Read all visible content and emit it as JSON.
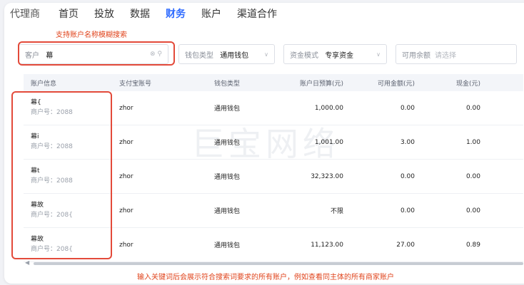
{
  "nav": {
    "brand": "代理商",
    "items": [
      "首页",
      "投放",
      "数据",
      "财务",
      "账户",
      "渠道合作"
    ],
    "active_index": 3
  },
  "hint_top": "支持账户名称模糊搜索",
  "filters": {
    "customer": {
      "label": "客户",
      "value": "幕"
    },
    "wallet": {
      "label": "钱包类型",
      "value": "通用钱包"
    },
    "fund": {
      "label": "资金模式",
      "value": "专享资金"
    },
    "balance": {
      "label": "可用余额",
      "placeholder": "请选择"
    }
  },
  "table": {
    "headers": [
      "账户信息",
      "支付宝账号",
      "钱包类型",
      "账户日预算(元)",
      "可用金额(元)",
      "现金(元)"
    ],
    "rows": [
      {
        "name": "幕{",
        "merchant": "商户号：2088",
        "alipay": "zhor",
        "wallet": "通用钱包",
        "budget": "1,000.00",
        "available": "0.00",
        "cash": "0.00"
      },
      {
        "name": "幕i",
        "merchant": "商户号：2088",
        "alipay": "zhor",
        "wallet": "通用钱包",
        "budget": "1,001.00",
        "available": "3.00",
        "cash": "1.00"
      },
      {
        "name": "幕t",
        "merchant": "商户号：2088",
        "alipay": "zhor",
        "wallet": "通用钱包",
        "budget": "32,323.00",
        "available": "0.00",
        "cash": "0.00"
      },
      {
        "name": "幕故",
        "merchant": "商户号：208{",
        "alipay": "zhor",
        "wallet": "通用钱包",
        "budget": "不限",
        "available": "0.00",
        "cash": "0.00"
      },
      {
        "name": "幕故",
        "merchant": "商户号：208{",
        "alipay": "zhor",
        "wallet": "通用钱包",
        "budget": "11,123.00",
        "available": "27.00",
        "cash": "0.89"
      }
    ]
  },
  "watermark": "巨宝网络",
  "hint_bottom": "输入关键词后会展示符合搜索词要求的所有账户，例如查看同主体的所有商家账户",
  "colors": {
    "accent": "#2f6bff",
    "annotation": "#e34a3a"
  }
}
